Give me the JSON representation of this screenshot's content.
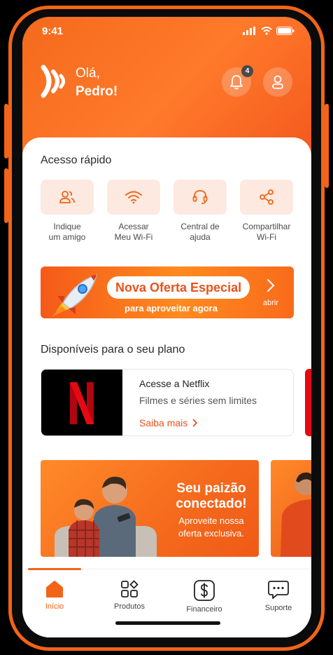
{
  "status_bar": {
    "time": "9:41"
  },
  "header": {
    "greeting": "Olá,",
    "name": "Pedro!",
    "notifications_count": "4"
  },
  "quick_access": {
    "title": "Acesso rápido",
    "items": [
      {
        "label": "Indique\num amigo",
        "icon": "users-icon"
      },
      {
        "label": "Acessar\nMeu Wi-Fi",
        "icon": "wifi-icon"
      },
      {
        "label": "Central de\najuda",
        "icon": "headset-icon"
      },
      {
        "label": "Compartilhar\nWi-Fi",
        "icon": "share-icon"
      }
    ]
  },
  "offer_banner": {
    "title": "Nova Oferta Especial",
    "subtitle": "para aproveitar agora",
    "action": "abrir"
  },
  "plan_section": {
    "title": "Disponíveis para o seu plano",
    "netflix": {
      "title": "Acesse a Netflix",
      "subtitle": "Filmes e séries sem limites",
      "link": "Saiba mais"
    }
  },
  "promo": {
    "headline": "Seu paizão conectado!",
    "body": "Aproveite nossa oferta exclusiva."
  },
  "tabbar": {
    "tabs": [
      {
        "label": "Início"
      },
      {
        "label": "Produtos"
      },
      {
        "label": "Financeiro"
      },
      {
        "label": "Suporte"
      }
    ]
  },
  "colors": {
    "brand": "#f26419",
    "tile": "#fde9df",
    "netflix_red": "#e50914"
  }
}
